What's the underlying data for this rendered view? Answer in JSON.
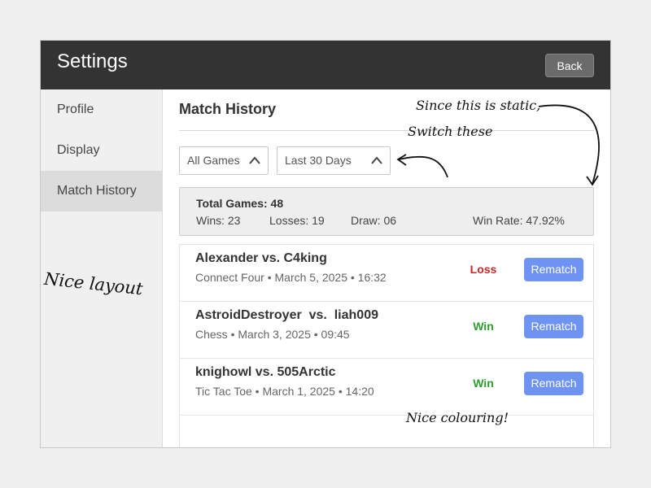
{
  "window": {
    "title": "Settings",
    "back_label": "Back"
  },
  "sidebar": {
    "items": [
      {
        "label": "Profile",
        "active": false
      },
      {
        "label": "Display",
        "active": false
      },
      {
        "label": "Match History",
        "active": true
      }
    ]
  },
  "main": {
    "title": "Match History",
    "filters": {
      "game": "All Games",
      "period": "Last 30 Days",
      "icon": "chevron-up-icon"
    },
    "stats": {
      "total": "Total Games: 48",
      "wins": "Wins: 23",
      "losses": "Losses: 19",
      "draw": "Draw: 06",
      "win_rate": "Win Rate: 47.92%"
    },
    "matches": [
      {
        "players": "Alexander vs. C4king",
        "details": "Connect Four • March 5, 2025 • 16:32",
        "result": "Loss",
        "action": "Rematch"
      },
      {
        "players": "AstroidDestroyer  vs.  liah009",
        "details": "Chess • March 3, 2025 • 09:45",
        "result": "Win",
        "action": "Rematch"
      },
      {
        "players": "knighowl vs. 505Arctic",
        "details": "Tic Tac Toe • March 1, 2025 • 14:20",
        "result": "Win",
        "action": "Rematch"
      }
    ]
  },
  "annotations": {
    "static_note_line1": "Since this is static,",
    "static_note_line2": "Switch these",
    "layout_note": "Nice layout",
    "colour_note": "Nice colouring!"
  },
  "colors": {
    "titlebar": "#333333",
    "accent": "#6f93f2",
    "loss": "#c62828",
    "win": "#2e9e2e"
  }
}
